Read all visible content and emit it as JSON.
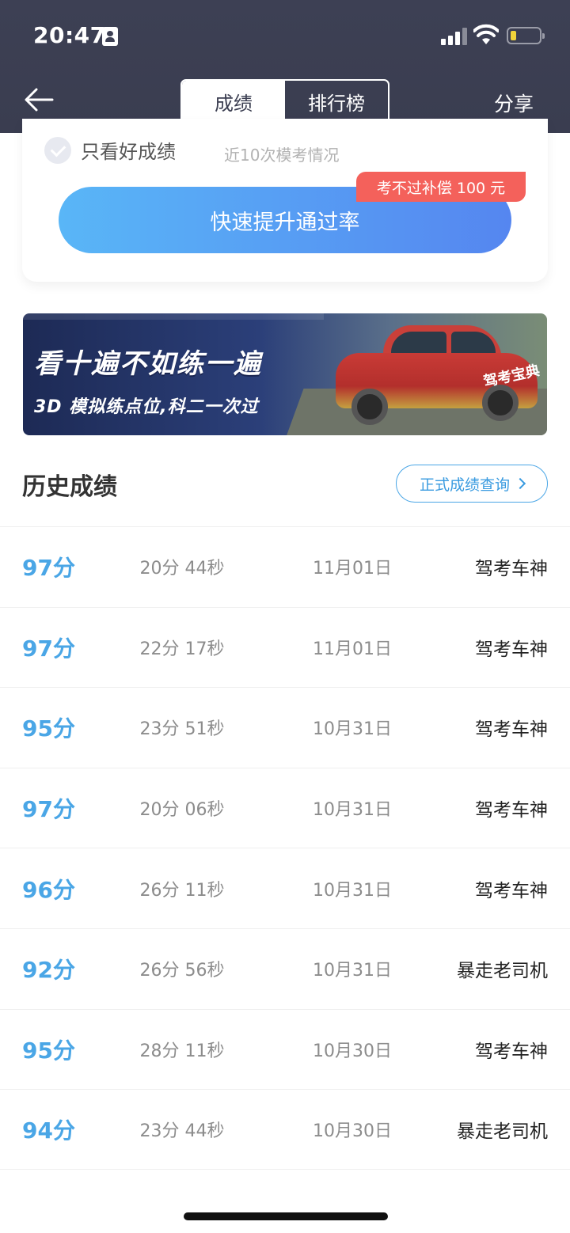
{
  "status_bar": {
    "time": "20:47",
    "icons": [
      "id-card-icon",
      "signal-icon",
      "wifi-icon",
      "battery-icon"
    ],
    "battery_level": 0.2
  },
  "nav": {
    "back_icon": "arrow-left-icon",
    "tabs": [
      {
        "label": "成绩",
        "active": true
      },
      {
        "label": "排行榜",
        "active": false
      }
    ],
    "share_label": "分享"
  },
  "card": {
    "checkbox_label": "只看好成绩",
    "checkbox_checked": false,
    "subtitle": "近10次模考情况",
    "promo_button": "快速提升通过率",
    "promo_tag": "考不过补偿 100 元"
  },
  "banner": {
    "title": "看十遍不如练一遍",
    "subtitle": "3D 模拟练点位,科二一次过",
    "car_text": "驾考宝典"
  },
  "history": {
    "title": "历史成绩",
    "query_button": "正式成绩查询",
    "rows": [
      {
        "score": "97分",
        "duration": "20分 44秒",
        "date": "11月01日",
        "title": "驾考车神"
      },
      {
        "score": "97分",
        "duration": "22分 17秒",
        "date": "11月01日",
        "title": "驾考车神"
      },
      {
        "score": "95分",
        "duration": "23分 51秒",
        "date": "10月31日",
        "title": "驾考车神"
      },
      {
        "score": "97分",
        "duration": "20分 06秒",
        "date": "10月31日",
        "title": "驾考车神"
      },
      {
        "score": "96分",
        "duration": "26分 11秒",
        "date": "10月31日",
        "title": "驾考车神"
      },
      {
        "score": "92分",
        "duration": "26分 56秒",
        "date": "10月31日",
        "title": "暴走老司机"
      },
      {
        "score": "95分",
        "duration": "28分 11秒",
        "date": "10月30日",
        "title": "驾考车神"
      },
      {
        "score": "94分",
        "duration": "23分 44秒",
        "date": "10月30日",
        "title": "暴走老司机"
      }
    ]
  },
  "colors": {
    "header_bg": "#3d4054",
    "accent_blue": "#4aa6e6",
    "promo_red": "#f4615b"
  }
}
